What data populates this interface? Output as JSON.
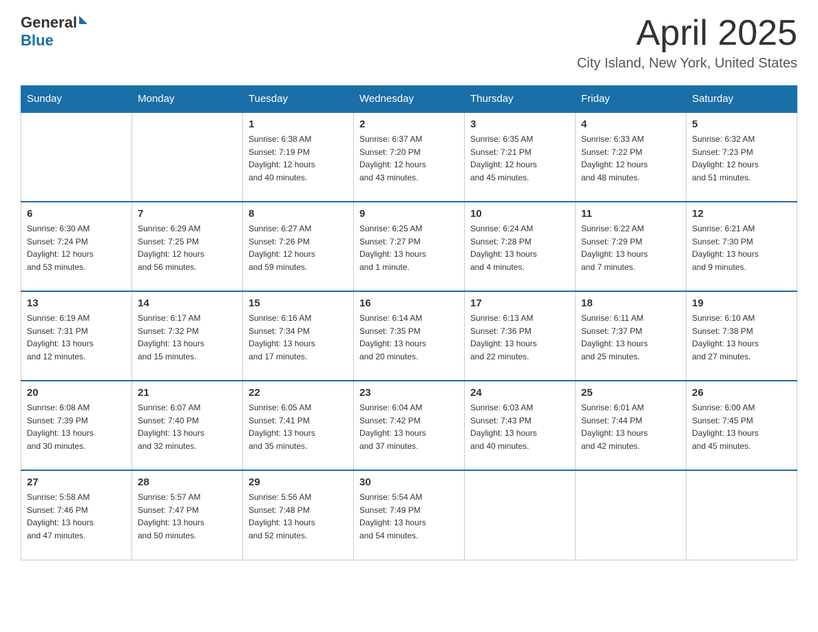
{
  "logo": {
    "general": "General",
    "blue": "Blue"
  },
  "title": "April 2025",
  "subtitle": "City Island, New York, United States",
  "headers": [
    "Sunday",
    "Monday",
    "Tuesday",
    "Wednesday",
    "Thursday",
    "Friday",
    "Saturday"
  ],
  "weeks": [
    [
      {
        "day": "",
        "info": ""
      },
      {
        "day": "",
        "info": ""
      },
      {
        "day": "1",
        "info": "Sunrise: 6:38 AM\nSunset: 7:19 PM\nDaylight: 12 hours\nand 40 minutes."
      },
      {
        "day": "2",
        "info": "Sunrise: 6:37 AM\nSunset: 7:20 PM\nDaylight: 12 hours\nand 43 minutes."
      },
      {
        "day": "3",
        "info": "Sunrise: 6:35 AM\nSunset: 7:21 PM\nDaylight: 12 hours\nand 45 minutes."
      },
      {
        "day": "4",
        "info": "Sunrise: 6:33 AM\nSunset: 7:22 PM\nDaylight: 12 hours\nand 48 minutes."
      },
      {
        "day": "5",
        "info": "Sunrise: 6:32 AM\nSunset: 7:23 PM\nDaylight: 12 hours\nand 51 minutes."
      }
    ],
    [
      {
        "day": "6",
        "info": "Sunrise: 6:30 AM\nSunset: 7:24 PM\nDaylight: 12 hours\nand 53 minutes."
      },
      {
        "day": "7",
        "info": "Sunrise: 6:29 AM\nSunset: 7:25 PM\nDaylight: 12 hours\nand 56 minutes."
      },
      {
        "day": "8",
        "info": "Sunrise: 6:27 AM\nSunset: 7:26 PM\nDaylight: 12 hours\nand 59 minutes."
      },
      {
        "day": "9",
        "info": "Sunrise: 6:25 AM\nSunset: 7:27 PM\nDaylight: 13 hours\nand 1 minute."
      },
      {
        "day": "10",
        "info": "Sunrise: 6:24 AM\nSunset: 7:28 PM\nDaylight: 13 hours\nand 4 minutes."
      },
      {
        "day": "11",
        "info": "Sunrise: 6:22 AM\nSunset: 7:29 PM\nDaylight: 13 hours\nand 7 minutes."
      },
      {
        "day": "12",
        "info": "Sunrise: 6:21 AM\nSunset: 7:30 PM\nDaylight: 13 hours\nand 9 minutes."
      }
    ],
    [
      {
        "day": "13",
        "info": "Sunrise: 6:19 AM\nSunset: 7:31 PM\nDaylight: 13 hours\nand 12 minutes."
      },
      {
        "day": "14",
        "info": "Sunrise: 6:17 AM\nSunset: 7:32 PM\nDaylight: 13 hours\nand 15 minutes."
      },
      {
        "day": "15",
        "info": "Sunrise: 6:16 AM\nSunset: 7:34 PM\nDaylight: 13 hours\nand 17 minutes."
      },
      {
        "day": "16",
        "info": "Sunrise: 6:14 AM\nSunset: 7:35 PM\nDaylight: 13 hours\nand 20 minutes."
      },
      {
        "day": "17",
        "info": "Sunrise: 6:13 AM\nSunset: 7:36 PM\nDaylight: 13 hours\nand 22 minutes."
      },
      {
        "day": "18",
        "info": "Sunrise: 6:11 AM\nSunset: 7:37 PM\nDaylight: 13 hours\nand 25 minutes."
      },
      {
        "day": "19",
        "info": "Sunrise: 6:10 AM\nSunset: 7:38 PM\nDaylight: 13 hours\nand 27 minutes."
      }
    ],
    [
      {
        "day": "20",
        "info": "Sunrise: 6:08 AM\nSunset: 7:39 PM\nDaylight: 13 hours\nand 30 minutes."
      },
      {
        "day": "21",
        "info": "Sunrise: 6:07 AM\nSunset: 7:40 PM\nDaylight: 13 hours\nand 32 minutes."
      },
      {
        "day": "22",
        "info": "Sunrise: 6:05 AM\nSunset: 7:41 PM\nDaylight: 13 hours\nand 35 minutes."
      },
      {
        "day": "23",
        "info": "Sunrise: 6:04 AM\nSunset: 7:42 PM\nDaylight: 13 hours\nand 37 minutes."
      },
      {
        "day": "24",
        "info": "Sunrise: 6:03 AM\nSunset: 7:43 PM\nDaylight: 13 hours\nand 40 minutes."
      },
      {
        "day": "25",
        "info": "Sunrise: 6:01 AM\nSunset: 7:44 PM\nDaylight: 13 hours\nand 42 minutes."
      },
      {
        "day": "26",
        "info": "Sunrise: 6:00 AM\nSunset: 7:45 PM\nDaylight: 13 hours\nand 45 minutes."
      }
    ],
    [
      {
        "day": "27",
        "info": "Sunrise: 5:58 AM\nSunset: 7:46 PM\nDaylight: 13 hours\nand 47 minutes."
      },
      {
        "day": "28",
        "info": "Sunrise: 5:57 AM\nSunset: 7:47 PM\nDaylight: 13 hours\nand 50 minutes."
      },
      {
        "day": "29",
        "info": "Sunrise: 5:56 AM\nSunset: 7:48 PM\nDaylight: 13 hours\nand 52 minutes."
      },
      {
        "day": "30",
        "info": "Sunrise: 5:54 AM\nSunset: 7:49 PM\nDaylight: 13 hours\nand 54 minutes."
      },
      {
        "day": "",
        "info": ""
      },
      {
        "day": "",
        "info": ""
      },
      {
        "day": "",
        "info": ""
      }
    ]
  ]
}
